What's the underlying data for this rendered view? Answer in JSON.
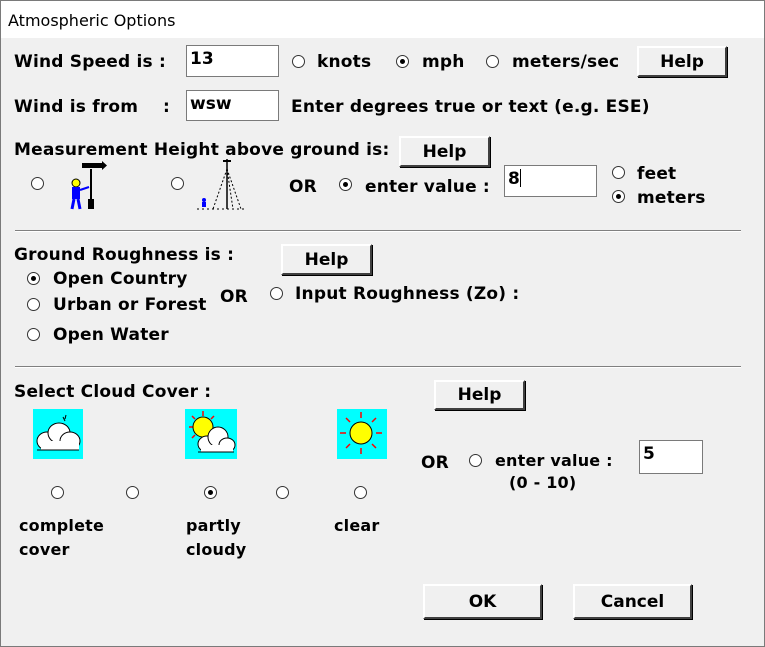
{
  "window": {
    "title": "Atmospheric Options"
  },
  "wind": {
    "speed_label": "Wind Speed is :",
    "speed_value": "13",
    "units": {
      "knots": "knots",
      "mph": "mph",
      "mps": "meters/sec",
      "selected": "mph"
    },
    "help": "Help",
    "from_label": "Wind is from",
    "from_colon": ":",
    "from_value": "wsw",
    "from_hint": "Enter degrees true or text (e.g. ESE)"
  },
  "measurement": {
    "label": "Measurement Height above ground is:",
    "help": "Help",
    "or": "OR",
    "enter_value": "enter value :",
    "value": "8",
    "unit_feet": "feet",
    "unit_meters": "meters",
    "selected_unit": "meters",
    "selected_option": "enter_value"
  },
  "roughness": {
    "label": "Ground Roughness is :",
    "help": "Help",
    "options": [
      "Open Country",
      "Urban or Forest",
      "Open Water"
    ],
    "selected": "Open Country",
    "or": "OR",
    "input_label": "Input Roughness (Zo) :"
  },
  "cloud": {
    "label": "Select Cloud Cover :",
    "help": "Help",
    "selected_index": 2,
    "label_complete_1": "complete",
    "label_complete_2": "cover",
    "label_partly_1": "partly",
    "label_partly_2": "cloudy",
    "label_clear": "clear",
    "or": "OR",
    "enter_value": "enter value :",
    "range": "(0 - 10)",
    "value": "5"
  },
  "actions": {
    "ok": "OK",
    "cancel": "Cancel"
  },
  "colors": {
    "sky": "#00ffff",
    "sun": "#ffff00",
    "figure": "#0000ff"
  }
}
